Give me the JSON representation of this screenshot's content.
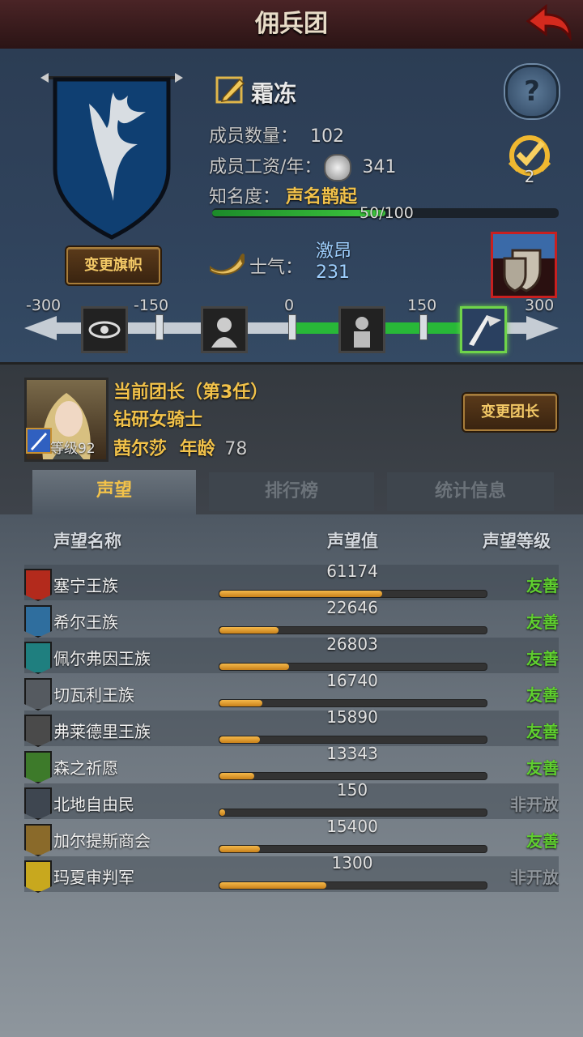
{
  "header": {
    "title": "佣兵团"
  },
  "guild": {
    "name": "霜冻",
    "members_label": "成员数量：",
    "members_value": "102",
    "wage_label": "成员工资/年：",
    "wage_value": "341",
    "fame_label": "知名度：",
    "fame_value": "声名鹊起",
    "fame_progress_text": "50/100",
    "fame_progress": 0.5,
    "change_banner_label": "变更旗帜",
    "quest_badge_count": "2",
    "morale_label": "士气：",
    "morale_state": "激昂",
    "morale_value": "231",
    "morale_ticks": [
      "-300",
      "-150",
      "0",
      "150",
      "300"
    ]
  },
  "leader": {
    "title": "当前团长（第3任）",
    "class": "钻研女骑士",
    "name": "茜尔莎",
    "age_label": "年龄",
    "age_value": "78",
    "level_text": "等级92",
    "change_leader_label": "变更团长"
  },
  "tabs": [
    {
      "label": "声望",
      "active": true
    },
    {
      "label": "排行榜",
      "active": false
    },
    {
      "label": "统计信息",
      "active": false
    }
  ],
  "table": {
    "headers": [
      "声望名称",
      "声望值",
      "声望等级"
    ],
    "rows": [
      {
        "name": "塞宁王族",
        "value": "61174",
        "progress": 0.61,
        "level": "友善",
        "level_color": "#5fcf2f",
        "icon_color": "#b32a1c"
      },
      {
        "name": "希尔王族",
        "value": "22646",
        "progress": 0.22,
        "level": "友善",
        "level_color": "#5fcf2f",
        "icon_color": "#2f6e9e"
      },
      {
        "name": "佩尔弗因王族",
        "value": "26803",
        "progress": 0.26,
        "level": "友善",
        "level_color": "#5fcf2f",
        "icon_color": "#1f7f7f"
      },
      {
        "name": "切瓦利王族",
        "value": "16740",
        "progress": 0.16,
        "level": "友善",
        "level_color": "#5fcf2f",
        "icon_color": "#555a60"
      },
      {
        "name": "弗莱德里王族",
        "value": "15890",
        "progress": 0.15,
        "level": "友善",
        "level_color": "#5fcf2f",
        "icon_color": "#4a4a4a"
      },
      {
        "name": "森之祈愿",
        "value": "13343",
        "progress": 0.13,
        "level": "友善",
        "level_color": "#5fcf2f",
        "icon_color": "#3d7a2a"
      },
      {
        "name": "北地自由民",
        "value": "150",
        "progress": 0.02,
        "level": "非开放",
        "level_color": "#8f959b",
        "icon_color": "#3e4650"
      },
      {
        "name": "加尔提斯商会",
        "value": "15400",
        "progress": 0.15,
        "level": "友善",
        "level_color": "#5fcf2f",
        "icon_color": "#8a6a2a"
      },
      {
        "name": "玛夏审判军",
        "value": "1300",
        "progress": 0.4,
        "level": "非开放",
        "level_color": "#8f959b",
        "icon_color": "#c8a81e"
      }
    ]
  }
}
